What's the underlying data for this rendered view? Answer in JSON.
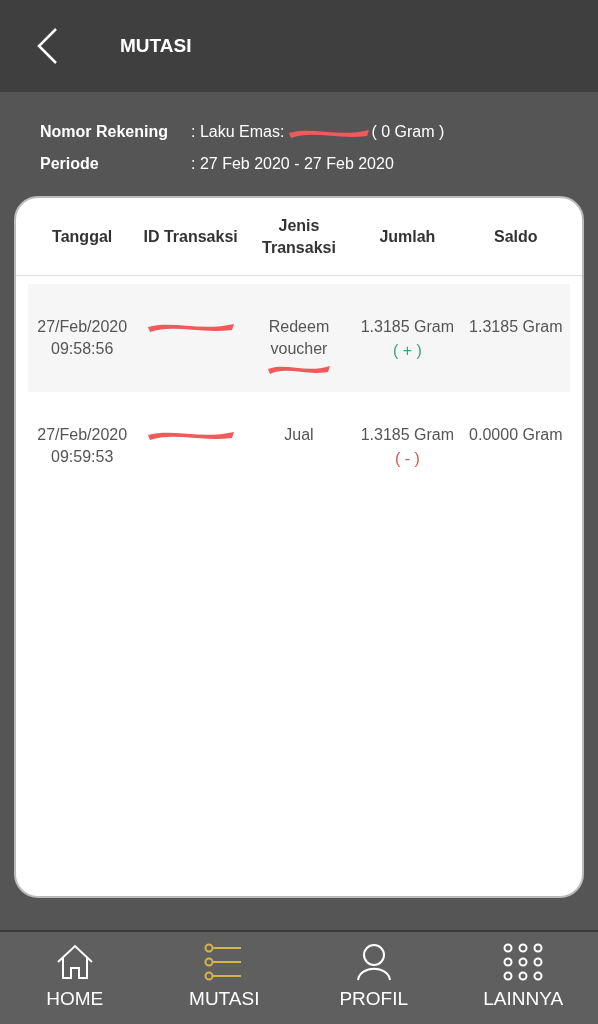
{
  "header": {
    "title": "MUTASI"
  },
  "info": [
    {
      "label": "Nomor Rekening",
      "prefix": ": Laku Emas:",
      "redacted": true,
      "suffix": "( 0 Gram )"
    },
    {
      "label": "Periode",
      "prefix": ": 27 Feb 2020 - 27 Feb 2020",
      "redacted": false
    }
  ],
  "table": {
    "columns": [
      "Tanggal",
      "ID Transaksi",
      "Jenis Transaksi",
      "Jumlah",
      "Saldo"
    ],
    "rows": [
      {
        "date": "27/Feb/2020",
        "time": "09:58:56",
        "id_redacted": true,
        "type": "Redeem voucher",
        "type_redacted": true,
        "amount": "1.3185 Gram",
        "sign": "( + )",
        "kind": "credit",
        "balance": "1.3185 Gram"
      },
      {
        "date": "27/Feb/2020",
        "time": "09:59:53",
        "id_redacted": true,
        "type": "Jual",
        "type_redacted": false,
        "amount": "1.3185 Gram",
        "sign": "( - )",
        "kind": "debit",
        "balance": "0.0000 Gram"
      }
    ]
  },
  "nav": [
    {
      "label": "HOME",
      "selected": false
    },
    {
      "label": "MUTASI",
      "selected": true
    },
    {
      "label": "PROFIL",
      "selected": false
    },
    {
      "label": "LAINNYA",
      "selected": false
    }
  ]
}
